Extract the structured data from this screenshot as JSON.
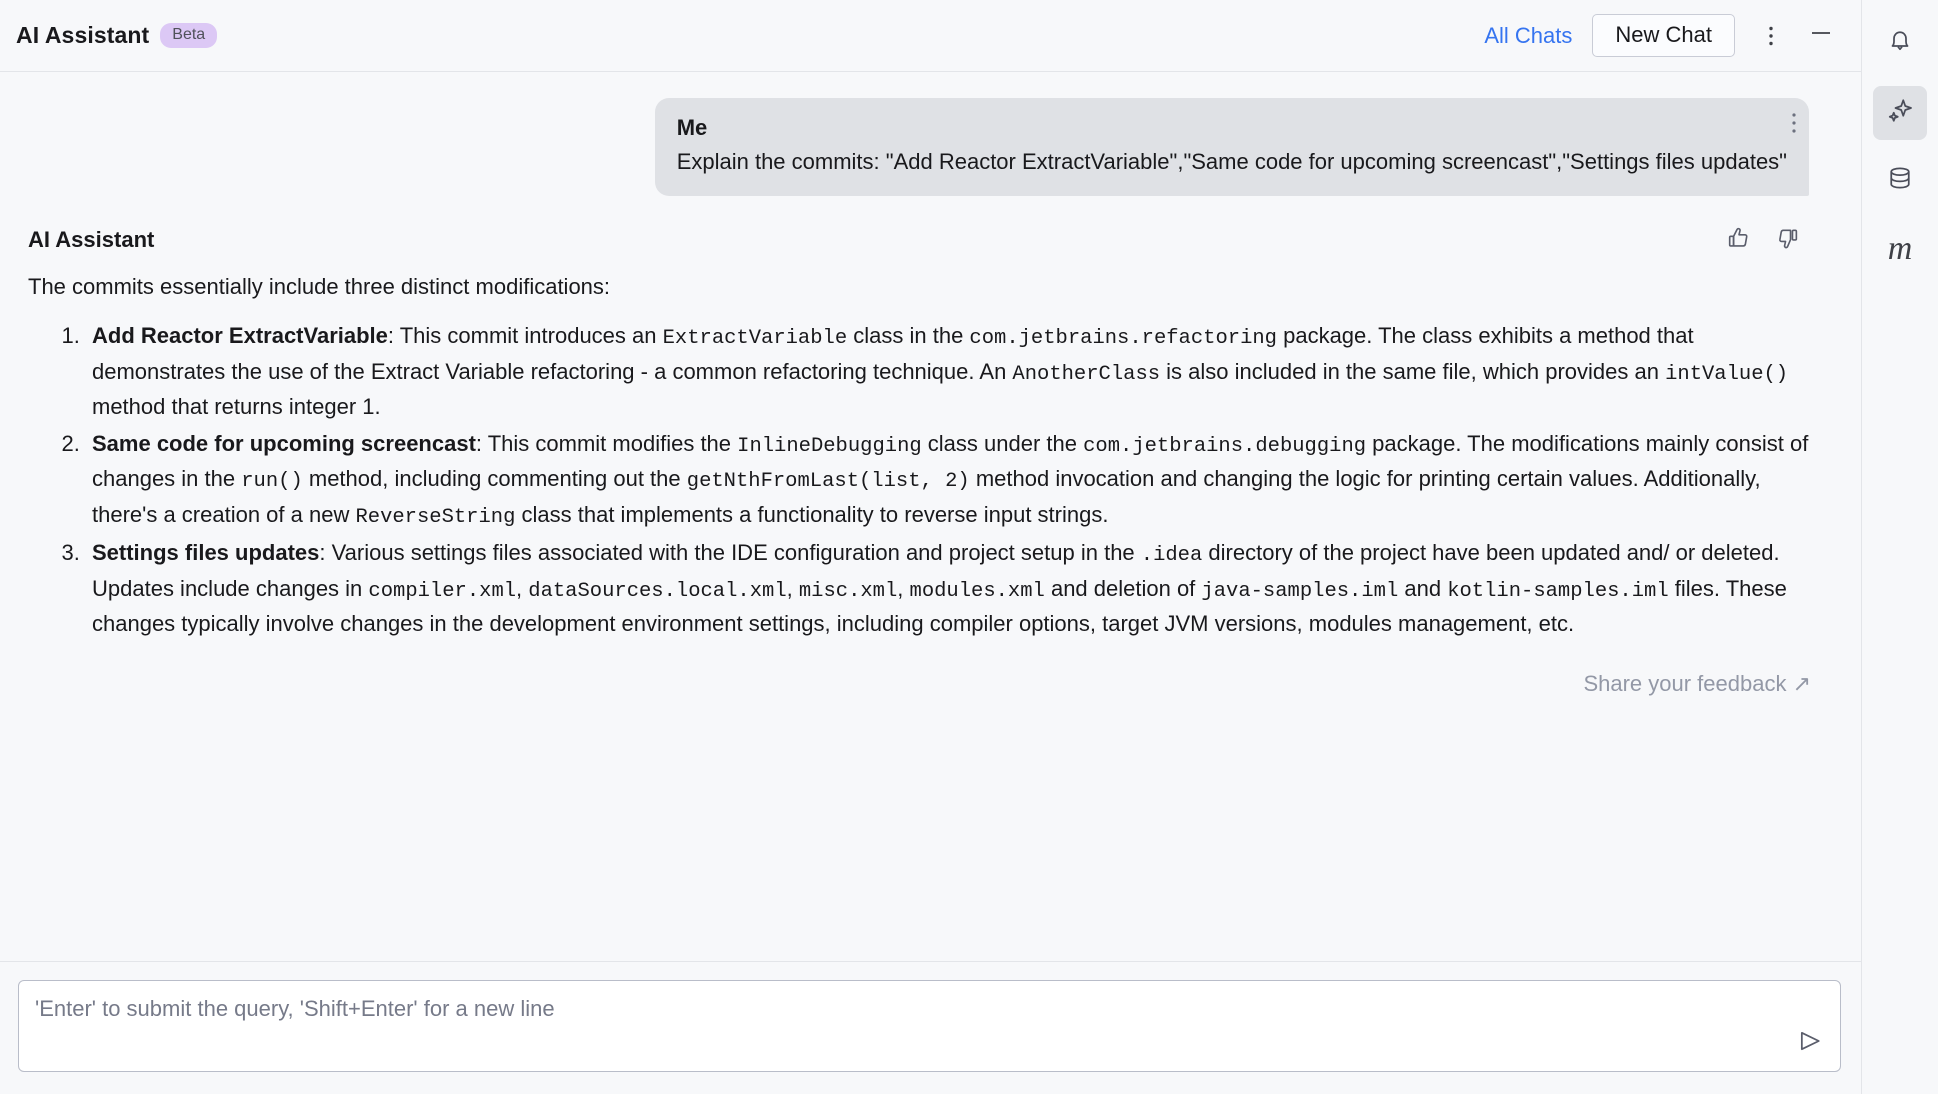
{
  "header": {
    "title": "AI Assistant",
    "badge": "Beta",
    "all_chats_label": "All Chats",
    "new_chat_label": "New Chat",
    "more_icon": "vertical-dots-icon",
    "minimize_icon": "minimize-icon"
  },
  "conversation": {
    "user_message": {
      "author": "Me",
      "text": "Explain the commits: \"Add Reactor ExtractVariable\",\"Same code for upcoming screencast\",\"Settings files updates\""
    },
    "assistant_message": {
      "author": "AI Assistant",
      "intro": "The commits essentially include three distinct modifications:",
      "items": [
        {
          "title": "Add Reactor ExtractVariable",
          "parts": [
            {
              "t": "text",
              "v": ": This commit introduces an "
            },
            {
              "t": "code",
              "v": "ExtractVariable"
            },
            {
              "t": "text",
              "v": " class in the "
            },
            {
              "t": "code",
              "v": "com.jetbrains.refactoring"
            },
            {
              "t": "text",
              "v": " package. The class exhibits a method that demonstrates the use of the Extract Variable refactoring - a common refactoring technique. An "
            },
            {
              "t": "code",
              "v": "AnotherClass"
            },
            {
              "t": "text",
              "v": " is also included in the same file, which provides an "
            },
            {
              "t": "code",
              "v": "intValue()"
            },
            {
              "t": "text",
              "v": " method that returns integer 1."
            }
          ]
        },
        {
          "title": "Same code for upcoming screencast",
          "parts": [
            {
              "t": "text",
              "v": ": This commit modifies the "
            },
            {
              "t": "code",
              "v": "InlineDebugging"
            },
            {
              "t": "text",
              "v": " class under the "
            },
            {
              "t": "code",
              "v": "com.jetbrains.debugging"
            },
            {
              "t": "text",
              "v": " package. The modifications mainly consist of changes in the "
            },
            {
              "t": "code",
              "v": "run()"
            },
            {
              "t": "text",
              "v": " method, including commenting out the "
            },
            {
              "t": "code",
              "v": "getNthFromLast(list, 2)"
            },
            {
              "t": "text",
              "v": " method invocation and changing the logic for printing certain values. Additionally, there's a creation of a new "
            },
            {
              "t": "code",
              "v": "ReverseString"
            },
            {
              "t": "text",
              "v": " class that implements a functionality to reverse input strings."
            }
          ]
        },
        {
          "title": "Settings files updates",
          "parts": [
            {
              "t": "text",
              "v": ": Various settings files associated with the IDE configuration and project setup in the "
            },
            {
              "t": "code",
              "v": ".idea"
            },
            {
              "t": "text",
              "v": " directory of the project have been updated and/ or deleted. Updates include changes in "
            },
            {
              "t": "code",
              "v": "compiler.xml"
            },
            {
              "t": "text",
              "v": ", "
            },
            {
              "t": "code",
              "v": "dataSources.local.xml"
            },
            {
              "t": "text",
              "v": ", "
            },
            {
              "t": "code",
              "v": "misc.xml"
            },
            {
              "t": "text",
              "v": ", "
            },
            {
              "t": "code",
              "v": "modules.xml"
            },
            {
              "t": "text",
              "v": " and deletion of "
            },
            {
              "t": "code",
              "v": "java-samples.iml"
            },
            {
              "t": "text",
              "v": " and "
            },
            {
              "t": "code",
              "v": "kotlin-samples.iml"
            },
            {
              "t": "text",
              "v": " files. These changes typically involve changes in the development environment settings, including compiler options, target JVM versions, modules management, etc."
            }
          ]
        }
      ],
      "thumbs_up_icon": "thumbs-up-icon",
      "thumbs_down_icon": "thumbs-down-icon",
      "message_more_icon": "vertical-dots-icon"
    },
    "share_feedback_label": "Share your feedback ↗"
  },
  "composer": {
    "placeholder": "'Enter' to submit the query, 'Shift+Enter' for a new line",
    "value": "",
    "send_icon": "send-icon"
  },
  "rail": {
    "items": [
      {
        "name": "notifications-bell-icon",
        "label": "",
        "active": false
      },
      {
        "name": "ai-sparkle-icon",
        "label": "",
        "active": true
      },
      {
        "name": "database-icon",
        "label": "",
        "active": false
      },
      {
        "name": "meetings-m-icon",
        "label": "m",
        "active": false
      }
    ]
  },
  "colors": {
    "accent_link": "#3574f0",
    "badge_bg": "#dcc8f5",
    "user_bubble_bg": "#dfe1e5",
    "page_bg": "#f7f8fa",
    "composer_border": "#b9bdc9"
  }
}
